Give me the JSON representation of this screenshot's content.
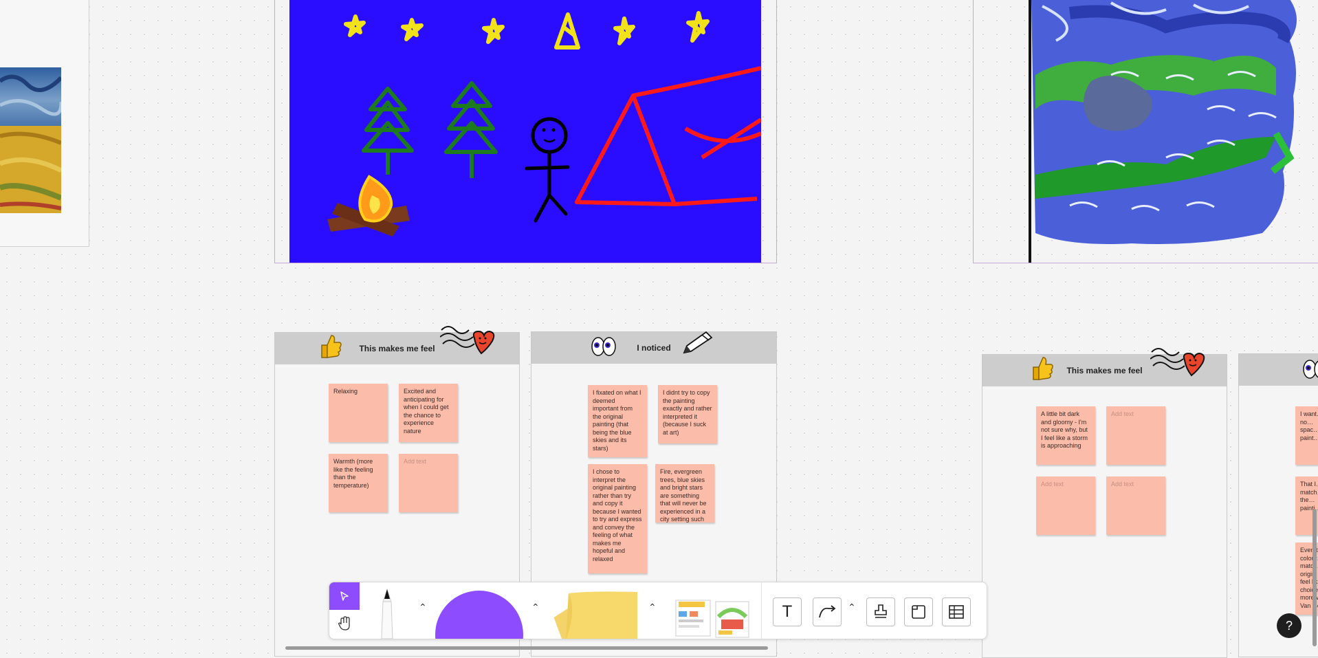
{
  "boards": [
    {
      "title": "This makes me feel",
      "notes": [
        "Relaxing",
        "Excited and anticipating for when I could get the chance to experience nature",
        "Warmth (more like the feeling than the temperature)",
        "Add text"
      ]
    },
    {
      "title": "I noticed",
      "notes": [
        "I fixated on what I deemed important from the original painting (that being the blue skies and its stars)",
        "I didnt try to copy the painting exactly and rather interpreted it (because I suck at art)",
        "I chose to interpret the original painting rather than try and copy it because I wanted to try and express and convey the feeling of what makes me hopeful and relaxed",
        "Fire, evergreen trees, blue skies and bright stars are something that will never be experienced in a city setting such as Vancouver"
      ]
    },
    {
      "title": "This makes me feel",
      "notes": [
        "A little bit dark and gloomy - I'm not sure why, but I feel like a storm is approaching",
        "Add text",
        "Add text",
        "Add text"
      ]
    },
    {
      "notes": [
        "I want… be no… spac… paint…",
        "That I… match… of the… painti…",
        "Even t… colour… match… origin… feel lik… choice… more v… Van Go…"
      ]
    }
  ],
  "toolbar": {
    "tools": [
      "select-tool",
      "hand-tool",
      "pen-tool",
      "shape-tool",
      "sticky-note-tool",
      "templates",
      "text-tool",
      "connector-tool",
      "stamp-tool",
      "section-tool",
      "table-tool"
    ],
    "text_tool_glyph": "T"
  },
  "help": {
    "label": "?"
  },
  "colors": {
    "accent": "#8d4dff",
    "sticky": "#fbbcaa",
    "canvas": "#f4f4f4",
    "night_sky": "#2a0dff"
  }
}
